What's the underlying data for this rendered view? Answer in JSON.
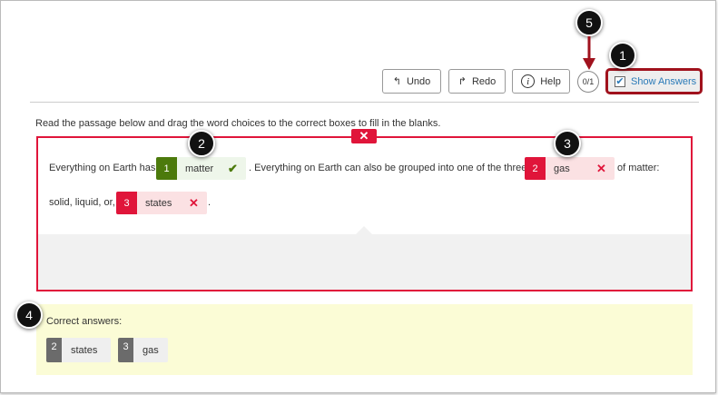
{
  "toolbar": {
    "undo": "Undo",
    "redo": "Redo",
    "help": "Help",
    "score": "0/1",
    "show_answers": "Show Answers"
  },
  "instructions": "Read the passage below and drag the word choices to the correct boxes to fill in the blanks.",
  "passage": {
    "t1": "Everything on Earth has",
    "t2": ". Everything on Earth can also be grouped into one of the three",
    "t3": "of matter:",
    "t4": "solid, liquid, or,",
    "t5": ".",
    "blanks": [
      {
        "num": "1",
        "word": "matter",
        "status": "correct"
      },
      {
        "num": "2",
        "word": "gas",
        "status": "incorrect"
      },
      {
        "num": "3",
        "word": "states",
        "status": "incorrect"
      }
    ]
  },
  "correct": {
    "label": "Correct answers:",
    "items": [
      {
        "num": "2",
        "word": "states"
      },
      {
        "num": "3",
        "word": "gas"
      }
    ]
  },
  "callouts": [
    "1",
    "2",
    "3",
    "4",
    "5"
  ],
  "colors": {
    "error": "#e0153a",
    "success": "#4c7a0c",
    "highlight": "#a0121d",
    "answers_bg": "#fbfcd6"
  }
}
